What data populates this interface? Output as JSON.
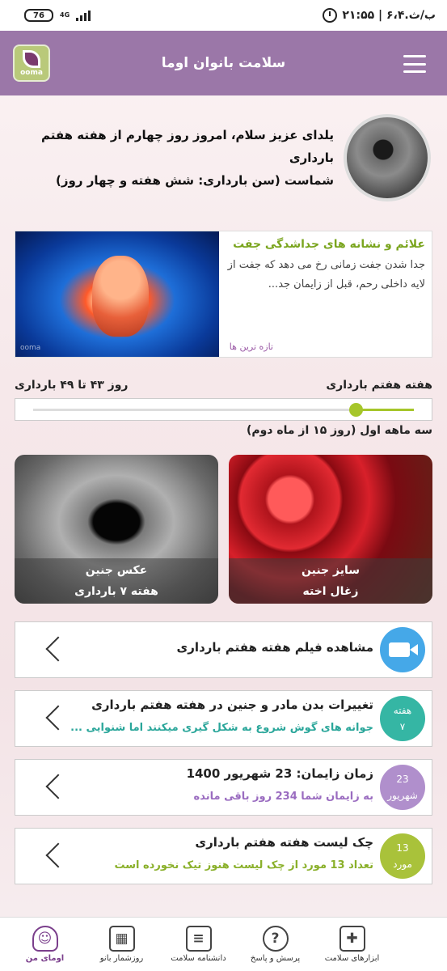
{
  "status_bar": {
    "time": "۲۱:۵۵ | ۶،۴.ب/ث",
    "battery": "76",
    "network": "4G"
  },
  "header": {
    "title": "سلامت بانوان اوما",
    "logo_text": "ooma"
  },
  "greeting": {
    "line1": "یلدای عزیز سلام، امروز روز چهارم از هفته هفتم بارداری",
    "line2": "شماست (سن بارداری: شش هفته و چهار روز)"
  },
  "article": {
    "title": "علائم و نشانه های جداشدگی جفت",
    "desc": "جدا شدن جفت زمانی رخ می دهد که جفت از لایه داخلی رحم، قبل از زایمان جد...",
    "tag": "تازه ترین ها",
    "image_watermark": "ooma"
  },
  "pregnancy": {
    "week_label": "هفته هفتم بارداری",
    "days_label": "روز ۴۳ تا ۴۹ بارداری",
    "trimester": "سه ماهه اول (روز ۱۵ از ماه دوم)",
    "progress": 0.15
  },
  "cards": [
    {
      "line1": "سایز جنین",
      "line2": "زغال اخته"
    },
    {
      "line1": "عکس جنین",
      "line2": "هفته ۷ بارداری"
    }
  ],
  "rows": [
    {
      "title": "مشاهده فیلم هفته هفتم بارداری",
      "icon": "video-camera-icon",
      "badge_color": "#45a8e8"
    },
    {
      "title": "تغییرات بدن مادر و جنین در هفته هفتم بارداری",
      "subtitle": "جوانه های گوش  شروع به شکل گیری میکنند اما شنوایی ...",
      "badge_line1": "هفته",
      "badge_line2": "۷",
      "badge_color": "#35b6a4",
      "sub_color": "#2aa69a"
    },
    {
      "title": "زمان زایمان: 23 شهریور 1400",
      "subtitle": "به زایمان شما 234 روز باقی مانده",
      "badge_line1": "23",
      "badge_line2": "شهریور",
      "badge_color": "#b08fcc",
      "sub_color": "#9a6cc0"
    },
    {
      "title": "چک لیست هفته هفتم بارداری",
      "subtitle": "تعداد 13 مورد از چک لیست هنوز تیک نخورده است",
      "badge_line1": "13",
      "badge_line2": "مورد",
      "badge_color": "#a9c23a",
      "sub_color": "#8ab02a"
    }
  ],
  "bottom_nav": [
    {
      "label": "ابزارهای سلامت",
      "icon": "medical-kit-icon",
      "glyph": "✚"
    },
    {
      "label": "پرسش و پاسخ",
      "icon": "question-bubble-icon",
      "glyph": "?"
    },
    {
      "label": "دانشنامه سلامت",
      "icon": "book-icon",
      "glyph": "≡"
    },
    {
      "label": "روزشمار بانو",
      "icon": "calendar-icon",
      "glyph": "▦"
    },
    {
      "label": "اومای من",
      "icon": "woman-profile-icon",
      "glyph": "☺"
    }
  ]
}
